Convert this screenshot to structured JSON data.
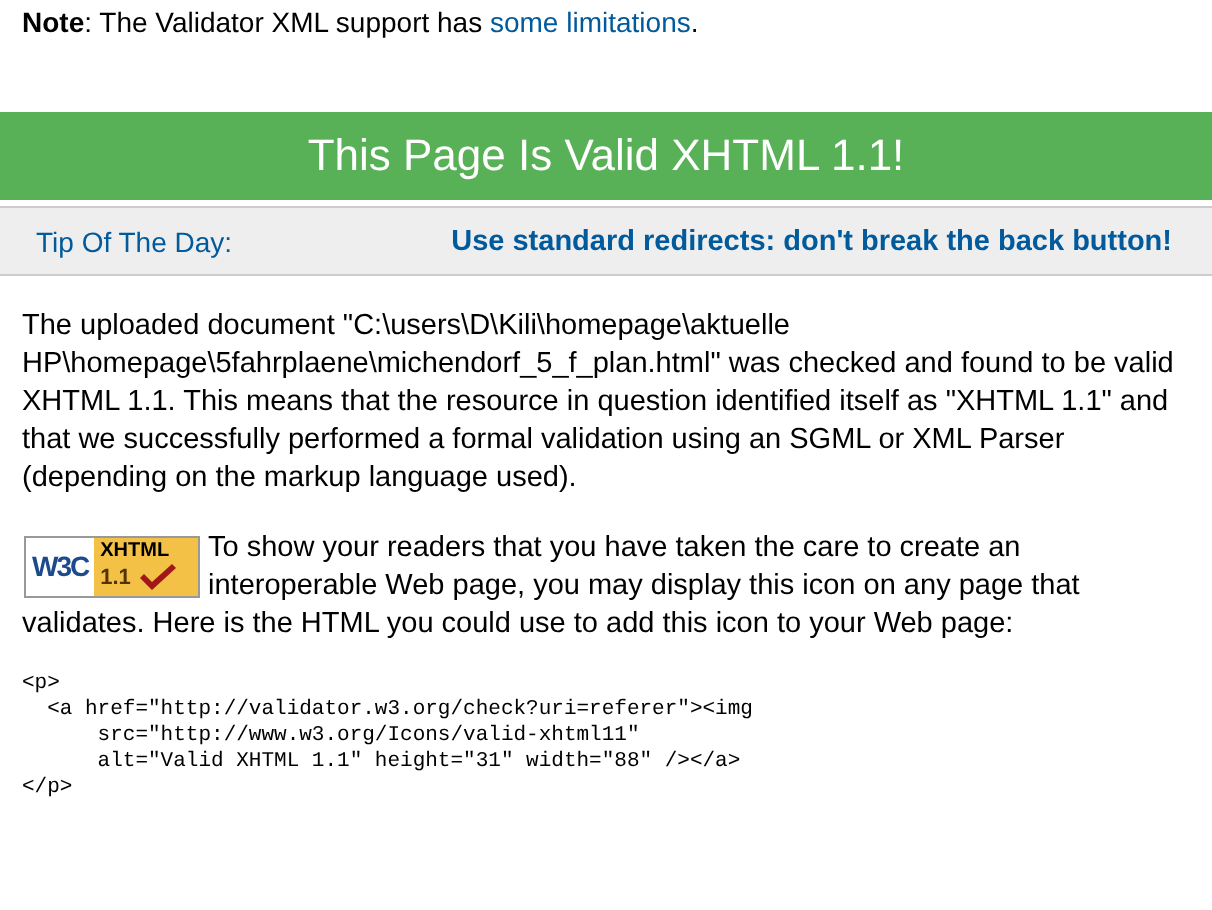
{
  "note": {
    "label": "Note",
    "text": ": The Validator XML support has ",
    "link": "some limitations",
    "end": "."
  },
  "banner": {
    "title": "This Page Is Valid XHTML 1.1!"
  },
  "tip": {
    "label": "Tip Of The Day:",
    "text": "Use standard redirects: don't break the back button!"
  },
  "result": "The uploaded document \"C:\\users\\D\\Kili\\homepage\\aktuelle HP\\homepage\\5fahrplaene\\michendorf_5_f_plan.html\" was checked and found to be valid XHTML 1.1. This means that the resource in question identified itself as \"XHTML 1.1\" and that we successfully performed a formal validation using an SGML or XML Parser (depending on the markup language used).",
  "badge": {
    "org": "W3C",
    "name": "XHTML",
    "version": "1.1"
  },
  "icon_text": [
    "To show your readers that you have taken the care to create an interoperable Web page, you may display this icon on any page that",
    "validates. Here is the HTML you could use to add this icon to your Web page:"
  ],
  "code": [
    "<p>",
    "  <a href=\"http://validator.w3.org/check?uri=referer\"><img",
    "      src=\"http://www.w3.org/Icons/valid-xhtml11\"",
    "      alt=\"Valid XHTML 1.1\" height=\"31\" width=\"88\" /></a>",
    "</p>"
  ]
}
